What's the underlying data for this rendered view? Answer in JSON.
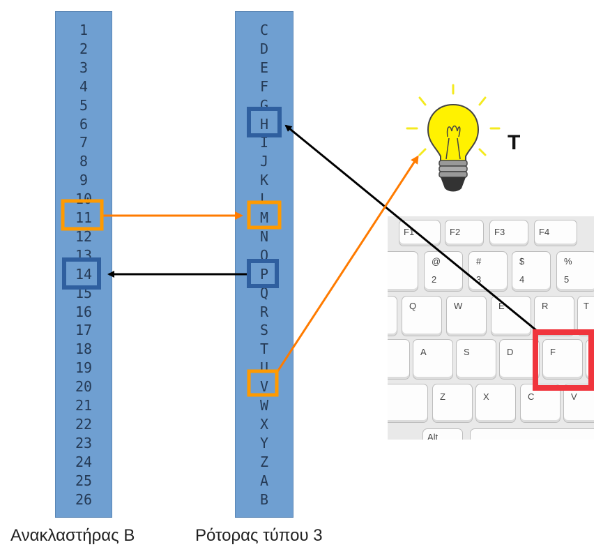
{
  "reflector": {
    "caption": "Ανακλαστήρας Β",
    "cells": [
      "1",
      "2",
      "3",
      "4",
      "5",
      "6",
      "7",
      "8",
      "9",
      "10",
      "11",
      "12",
      "13",
      "14",
      "15",
      "16",
      "17",
      "18",
      "19",
      "20",
      "21",
      "22",
      "23",
      "24",
      "25",
      "26"
    ]
  },
  "rotor": {
    "caption": "Ρότορας τύπου 3",
    "cells": [
      "C",
      "D",
      "E",
      "F",
      "G",
      "H",
      "I",
      "J",
      "K",
      "L",
      "M",
      "N",
      "O",
      "P",
      "Q",
      "R",
      "S",
      "T",
      "U",
      "V",
      "W",
      "X",
      "Y",
      "Z",
      "A",
      "B"
    ]
  },
  "highlights": {
    "reflector_in": "11",
    "reflector_out": "14",
    "rotor_in": "M",
    "rotor_out": "P",
    "rotor_from_key": "H",
    "rotor_to_lamp": "V",
    "pressed_key": "F"
  },
  "lamp": {
    "label": "T"
  },
  "keyboard": {
    "fn_keys": [
      "F1",
      "F2",
      "F3",
      "F4"
    ],
    "number_keys": [
      {
        "top": "@",
        "bottom": "2"
      },
      {
        "top": "#",
        "bottom": "3"
      },
      {
        "top": "$",
        "bottom": "4"
      },
      {
        "top": "%",
        "bottom": "5"
      }
    ],
    "row_q": [
      "Q",
      "W",
      "E",
      "R",
      "T"
    ],
    "row_a": [
      "A",
      "S",
      "D",
      "F"
    ],
    "row_z": [
      "Z",
      "X",
      "C",
      "V"
    ],
    "alt": "Alt"
  },
  "colors": {
    "column": "#6f9fd1",
    "orange": "#ff7b00",
    "blue_box": "#2f5f9f",
    "black_arrow": "#000000",
    "key_highlight": "#f0353d",
    "bulb": "#fff200"
  }
}
